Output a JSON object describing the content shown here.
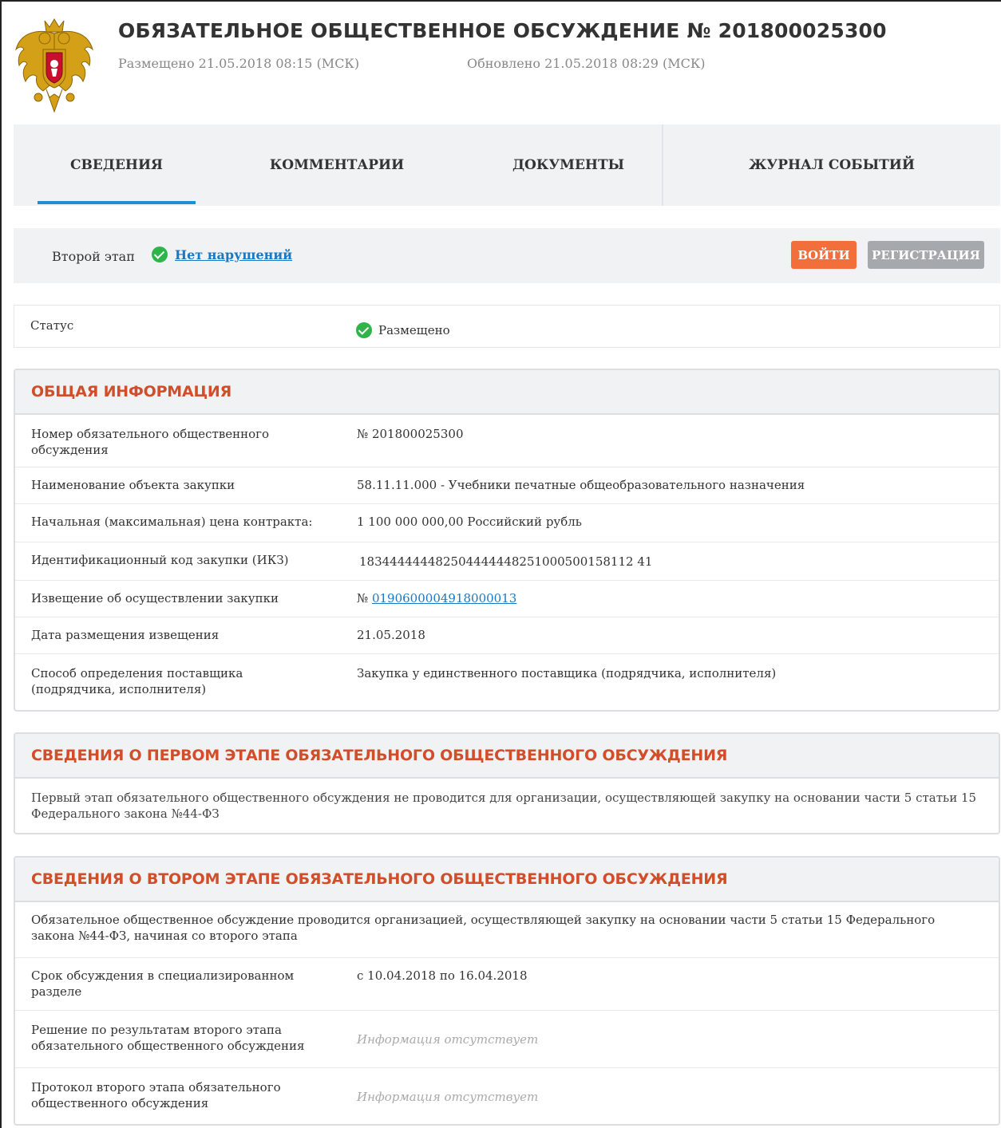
{
  "header": {
    "title": "ОБЯЗАТЕЛЬНОЕ ОБЩЕСТВЕННОЕ ОБСУЖДЕНИЕ № 201800025300",
    "posted": "Размещено 21.05.2018 08:15 (МСК)",
    "updated": "Обновлено 21.05.2018 08:29 (МСК)",
    "emblem_icon": "russian-coat-of-arms"
  },
  "tabs": [
    {
      "label": "СВЕДЕНИЯ",
      "active": true
    },
    {
      "label": "КОММЕНТАРИИ",
      "active": false
    },
    {
      "label": "ДОКУМЕНТЫ",
      "active": false
    },
    {
      "label": "ЖУРНАЛ СОБЫТИЙ",
      "active": false
    }
  ],
  "stage": {
    "label": "Второй этап",
    "link": "Нет нарушений",
    "login_label": "ВОЙТИ",
    "register_label": "РЕГИСТРАЦИЯ"
  },
  "status": {
    "label": "Статус",
    "value": "Размещено"
  },
  "general": {
    "title": "ОБЩАЯ ИНФОРМАЦИЯ",
    "rows": [
      {
        "k": "Номер обязательного общественного обсуждения",
        "v": "№ 201800025300"
      },
      {
        "k": "Наименование объекта закупки",
        "v": "58.11.11.000 - Учебники печатные общеобразовательного назначения"
      },
      {
        "k": "Начальная (максимальная) цена контракта:",
        "v": "1 100 000 000,00 Российский рубль"
      },
      {
        "k": "Идентификационный код закупки (ИКЗ)",
        "v": "183444444482504444448251000500158112 41"
      },
      {
        "k": "Извещение об осуществлении закупки",
        "v_prefix": "№ ",
        "v_link": "0190600004918000013"
      },
      {
        "k": "Дата размещения извещения",
        "v": "21.05.2018"
      },
      {
        "k": "Способ определения поставщика (подрядчика, исполнителя)",
        "v": "Закупка у единственного поставщика (подрядчика, исполнителя)"
      }
    ]
  },
  "first_stage": {
    "title": "СВЕДЕНИЯ О ПЕРВОМ ЭТАПЕ ОБЯЗАТЕЛЬНОГО ОБЩЕСТВЕННОГО ОБСУЖДЕНИЯ",
    "text": "Первый этап обязательного общественного обсуждения не проводится для организации, осуществляющей закупку на основании части 5 статьи 15 Федерального закона №44-ФЗ"
  },
  "second_stage": {
    "title": "СВЕДЕНИЯ О ВТОРОМ ЭТАПЕ ОБЯЗАТЕЛЬНОГО ОБЩЕСТВЕННОГО ОБСУЖДЕНИЯ",
    "text": "Обязательное общественное обсуждение проводится организацией, осуществляющей закупку на основании части 5 статьи 15 Федерального закона №44-ФЗ, начиная со второго этапа",
    "rows": [
      {
        "k": "Срок обсуждения в специализированном разделе",
        "v": "с 10.04.2018 по 16.04.2018"
      },
      {
        "k": "Решение по результатам второго этапа обязательного общественного обсуждения",
        "v": "Информация отсутствует"
      },
      {
        "k": "Протокол второго этапа обязательного общественного обсуждения",
        "v": "Информация отсутствует"
      }
    ]
  }
}
